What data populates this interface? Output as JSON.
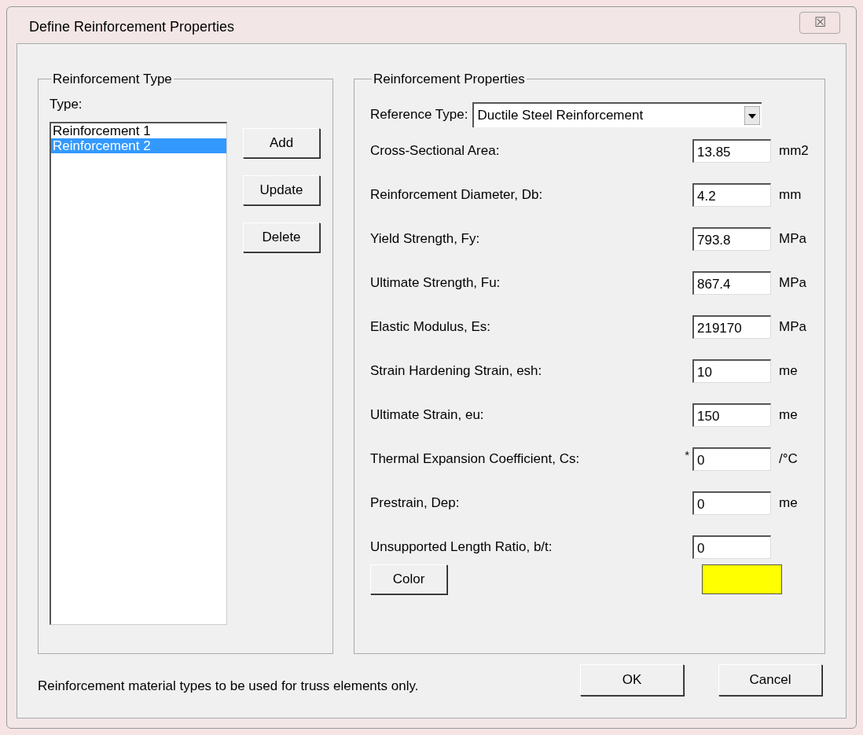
{
  "window": {
    "title": "Define Reinforcement Properties",
    "close": "☒"
  },
  "type_group": {
    "title": "Reinforcement Type",
    "list_label": "Type:",
    "items": [
      {
        "label": "Reinforcement 1",
        "selected": false
      },
      {
        "label": "Reinforcement 2",
        "selected": true
      }
    ],
    "buttons": [
      "Add",
      "Update",
      "Delete"
    ]
  },
  "properties_group": {
    "title": "Reinforcement Properties",
    "reference_type": {
      "label": "Reference Type:",
      "value": "Ductile Steel Reinforcement"
    },
    "fields": [
      {
        "label": "Cross-Sectional Area:",
        "value": "13.85",
        "unit": "mm2"
      },
      {
        "label": "Reinforcement Diameter, Db:",
        "value": "4.2",
        "unit": "mm"
      },
      {
        "label": "Yield Strength, Fy:",
        "value": "793.8",
        "unit": "MPa"
      },
      {
        "label": "Ultimate Strength, Fu:",
        "value": "867.4",
        "unit": "MPa"
      },
      {
        "label": "Elastic Modulus, Es:",
        "value": "219170",
        "unit": "MPa"
      },
      {
        "label": "Strain Hardening Strain, esh:",
        "value": "10",
        "unit": "me"
      },
      {
        "label": "Ultimate Strain, eu:",
        "value": "150",
        "unit": "me"
      },
      {
        "label": "Thermal Expansion Coefficient, Cs:",
        "marker": "*",
        "value": "0",
        "unit": "/°C"
      },
      {
        "label": "Prestrain, Dep:",
        "value": "0",
        "unit": "me"
      },
      {
        "label": "Unsupported Length Ratio, b/t:",
        "value": "0"
      }
    ],
    "color_button": "Color",
    "color": "#ffff00"
  },
  "footer": {
    "note": "Reinforcement material types to be used for truss elements only.",
    "buttons": [
      "OK",
      "Cancel"
    ]
  }
}
